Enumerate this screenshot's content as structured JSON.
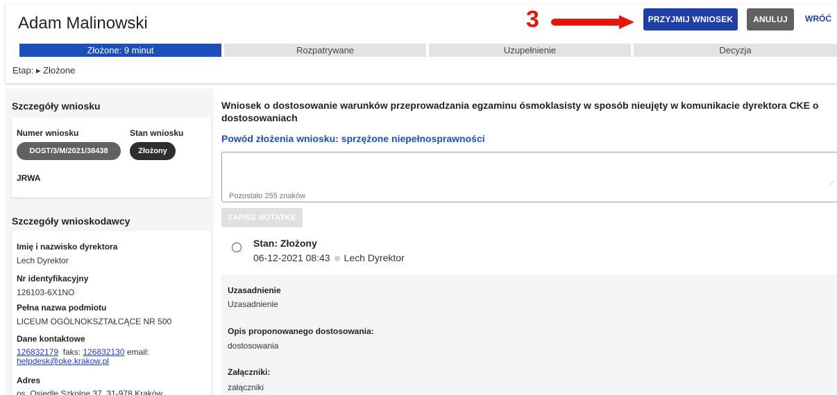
{
  "header": {
    "person_name": "Adam Malinowski",
    "annotation_number": "3",
    "accept_label": "PRZYJMIJ WNIOSEK",
    "cancel_label": "ANULUJ",
    "back_label": "WRÓĆ"
  },
  "stages": [
    {
      "label": "Złożone: 9 minut",
      "active": true
    },
    {
      "label": "Rozpatrywane",
      "active": false
    },
    {
      "label": "Uzupełnienie",
      "active": false
    },
    {
      "label": "Decyzja",
      "active": false
    }
  ],
  "etap": "Etap: ▸ Złożone",
  "application_details": {
    "title": "Szczegóły wniosku",
    "number_label": "Numer wniosku",
    "number_value": "DOST/3/M/2021/38438",
    "status_label": "Stan wniosku",
    "status_value": "Złożony",
    "jrwa": "JRWA"
  },
  "applicant_details": {
    "title": "Szczegóły wnioskodawcy",
    "director_label": "Imię i nazwisko dyrektora",
    "director_value": "Lech Dyrektor",
    "id_label": "Nr identyfikacyjny",
    "id_value": "126103-6X1NO",
    "entity_label": "Pełna nazwa podmiotu",
    "entity_value": "LICEUM OGÓLNOKSZTAŁCĄCE NR 500",
    "contact_label": "Dane kontaktowe",
    "phone": "126832179",
    "fax_prefix": "faks:",
    "fax": "126832130",
    "email_prefix": "email:",
    "email": "helpdesk@oke.krakow.pl",
    "address_label": "Adres",
    "address_value": "os. Osiedle Szkolne 37, 31-978 Kraków"
  },
  "main": {
    "title": "Wniosek o dostosowanie warunków przeprowadzania egzaminu ósmoklasisty w sposób nieujęty w komunikacie dyrektora CKE o dostosowaniach",
    "reason": "Powód złożenia wniosku: sprzężone niepełnosprawności",
    "note_value": "",
    "note_counter": "Pozostało 255 znaków",
    "save_note_label": "ZAPISZ NOTATKĘ",
    "state_title": "Stan: Złożony",
    "state_datetime": "06-12-2021 08:43",
    "state_author": "Lech Dyrektor",
    "justification_label": "Uzasadnienie",
    "justification_value": "Uzasadnienie",
    "proposal_label": "Opis proponowanego dostosowania:",
    "proposal_value": "dostosowania",
    "attachments_label": "Załączniki:",
    "attachments_value": "załączniki"
  },
  "colors": {
    "primary": "#1d3fa6",
    "stage_active": "#1d4fba",
    "annotation": "#e8140a"
  }
}
